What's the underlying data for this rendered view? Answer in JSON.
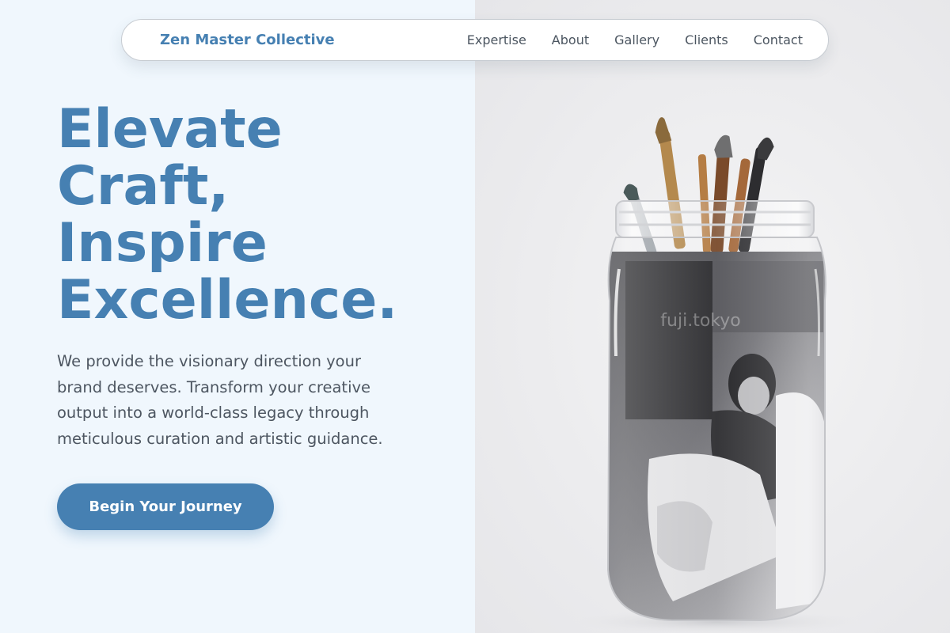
{
  "nav": {
    "brand": "Zen Master Collective",
    "links": [
      {
        "label": "Expertise"
      },
      {
        "label": "About"
      },
      {
        "label": "Gallery"
      },
      {
        "label": "Clients"
      },
      {
        "label": "Contact"
      }
    ]
  },
  "hero": {
    "headline_lines": [
      "Elevate",
      "Craft,",
      "Inspire",
      "Excellence."
    ],
    "description": "We provide the visionary direction your brand deserves. Transform your creative output into a world-class legacy through meticulous curation and artistic guidance.",
    "cta_label": "Begin Your Journey"
  },
  "image": {
    "subject": "glass jar with paint brushes over a black and white photograph of a woman",
    "watermark": "fuji.tokyo"
  },
  "colors": {
    "accent": "#4680b2",
    "left_background": "#f0f7fd",
    "right_background": "#ececee",
    "body_text": "#4d5661"
  }
}
